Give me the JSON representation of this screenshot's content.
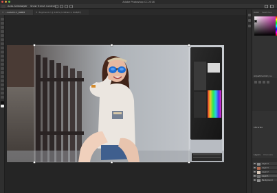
{
  "app": {
    "window_title": "Adobe Photoshop CC 2018"
  },
  "options_bar": {
    "auto_select_label": "Auto-Select:",
    "auto_select_value": "Layer",
    "show_transform_label": "Show Transf. Controls"
  },
  "tabs": [
    {
      "label": "…Autumn 1_RGB/8",
      "active": true
    },
    {
      "label": "Boyfriend 2 @ 100% (Untitled-1, RGB/8*)",
      "active": false
    }
  ],
  "panels": {
    "color_tab": "Color",
    "swatches_tab": "Swatches",
    "adjustments_tab": "Adjustments",
    "styles_tab": "Styles",
    "libraries_tab": "Libraries",
    "layers_tab": "Layers",
    "channels_tab": "Channels",
    "layers": [
      {
        "name": "Layer 4",
        "thumb_color": "#8a8a8a"
      },
      {
        "name": "Layer 3",
        "thumb_color": "#b46a4e"
      },
      {
        "name": "Layer 2",
        "thumb_color": "#d8c7b8"
      },
      {
        "name": "Layer 1",
        "thumb_color": "#6f6f6f"
      },
      {
        "name": "Background",
        "thumb_color": "#8e8e8e"
      }
    ]
  },
  "colors": {
    "chrome_dark": "#282828",
    "panel": "#323232",
    "accent_magenta": "#d33bb5",
    "mac_red": "#e0534b",
    "mac_yellow": "#dca13c",
    "mac_green": "#5ebb4b"
  }
}
